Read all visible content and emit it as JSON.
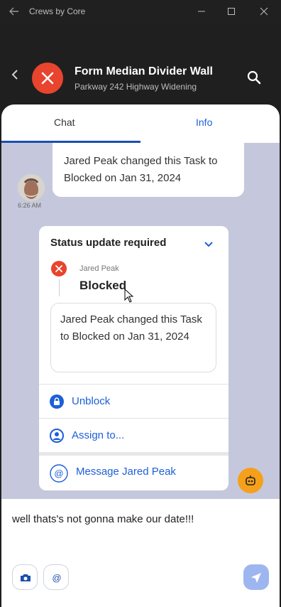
{
  "window": {
    "title": "Crews by Core",
    "icons": [
      "back-arrow-icon",
      "minimize-icon",
      "maximize-icon",
      "close-icon"
    ]
  },
  "header": {
    "title": "Form Median Divider Wall",
    "subtitle": "Parkway 242 Highway Widening",
    "status_color": "#e8442e",
    "icons": [
      "chevron-left-icon",
      "blocked-x-icon",
      "search-icon"
    ]
  },
  "tabs": [
    {
      "label": "Chat",
      "active": true
    },
    {
      "label": "Info",
      "active": false
    }
  ],
  "chat": {
    "message": {
      "text": "Jared Peak changed this Task to Blocked on Jan 31, 2024",
      "time": "6:26 AM"
    }
  },
  "status_card": {
    "title": "Status update required",
    "user": "Jared Peak",
    "status": "Blocked",
    "message": "Jared Peak changed this Task to Blocked on Jan 31, 2024",
    "actions": [
      {
        "label": "Unblock",
        "icon": "lock-icon"
      },
      {
        "label": "Assign to...",
        "icon": "user-icon"
      },
      {
        "label": "Message Jared Peak",
        "icon": "at-icon"
      }
    ]
  },
  "composer": {
    "text": "well thats's not gonna make our date!!!",
    "buttons": [
      "camera-icon",
      "at-icon",
      "send-icon"
    ]
  },
  "colors": {
    "accent": "#1d5fd8",
    "blocked": "#e8442e",
    "bot": "#f5a01a",
    "chat_bg": "#c5c8dc"
  }
}
